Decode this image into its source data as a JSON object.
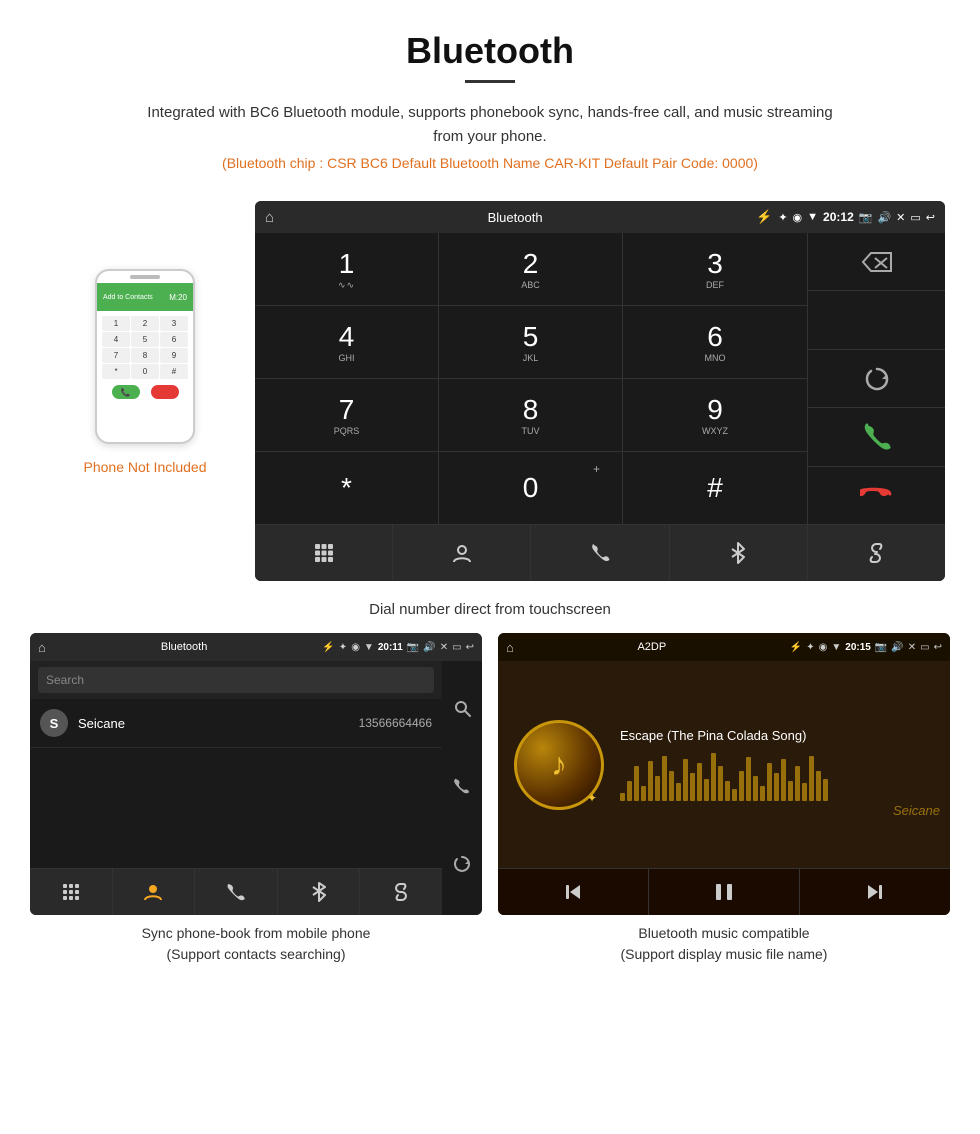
{
  "header": {
    "title": "Bluetooth",
    "description": "Integrated with BC6 Bluetooth module, supports phonebook sync, hands-free call, and music streaming from your phone.",
    "specs": "(Bluetooth chip : CSR BC6    Default Bluetooth Name CAR-KIT    Default Pair Code: 0000)"
  },
  "dial_screen": {
    "status_bar": {
      "home_icon": "⌂",
      "title": "Bluetooth",
      "usb_icon": "⚡",
      "time": "20:12",
      "icons": "✦ ◉ ▼ 📷 🔊 ✕ ▭ ↩"
    },
    "keys": [
      {
        "number": "1",
        "sub": "∿∿"
      },
      {
        "number": "2",
        "sub": "ABC"
      },
      {
        "number": "3",
        "sub": "DEF"
      },
      {
        "number": "4",
        "sub": "GHI"
      },
      {
        "number": "5",
        "sub": "JKL"
      },
      {
        "number": "6",
        "sub": "MNO"
      },
      {
        "number": "7",
        "sub": "PQRS"
      },
      {
        "number": "8",
        "sub": "TUV"
      },
      {
        "number": "9",
        "sub": "WXYZ"
      },
      {
        "number": "*",
        "sub": ""
      },
      {
        "number": "0",
        "sub": "+"
      },
      {
        "number": "#",
        "sub": ""
      }
    ],
    "caption": "Dial number direct from touchscreen"
  },
  "phone_aside": {
    "not_included_text": "Phone Not Included"
  },
  "phonebook_screen": {
    "status_bar_title": "Bluetooth",
    "time": "20:11",
    "search_placeholder": "Search",
    "contact_letter": "S",
    "contact_name": "Seicane",
    "contact_number": "13566664466"
  },
  "music_screen": {
    "status_bar_title": "A2DP",
    "time": "20:15",
    "song_title": "Escape (The Pina Colada Song)",
    "watermark": "Seicane"
  },
  "captions": {
    "phonebook": "Sync phone-book from mobile phone\n(Support contacts searching)",
    "music": "Bluetooth music compatible\n(Support display music file name)"
  },
  "viz_bars": [
    8,
    20,
    35,
    15,
    40,
    25,
    45,
    30,
    18,
    42,
    28,
    38,
    22,
    48,
    35,
    20,
    12,
    30,
    44,
    25,
    15,
    38,
    28,
    42,
    20,
    35,
    18,
    45,
    30,
    22
  ]
}
